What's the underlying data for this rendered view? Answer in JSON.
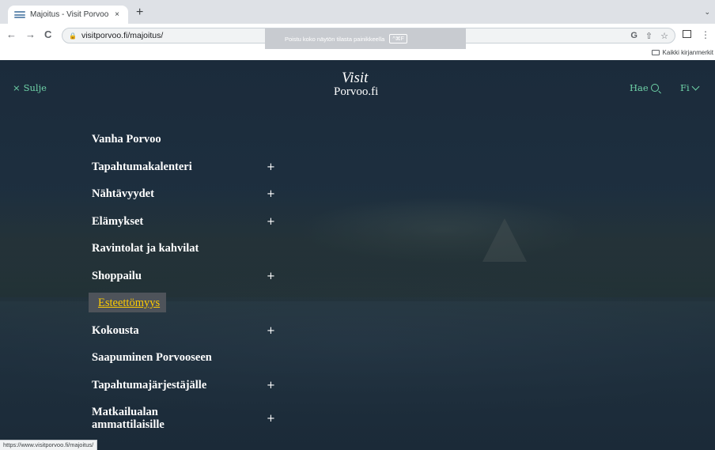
{
  "browser": {
    "tab": {
      "title": "Majoitus - Visit Porvoo",
      "close": "×"
    },
    "new_tab": "+",
    "tab_menu": "⌄",
    "nav": {
      "back": "←",
      "forward": "→",
      "reload": "C"
    },
    "url": "visitporvoo.fi/majoitus/",
    "omni_icons": {
      "google": "G",
      "share": "⇧",
      "star": "☆"
    },
    "fullscreen_banner": {
      "text": "Poistu koko näytön tilasta painikkeella",
      "key": "^⌘F"
    },
    "bookmarks_folder": "Kaikki kirjanmerkit",
    "status_url": "https://www.visitporvoo.fi/majoitus/"
  },
  "header": {
    "close_icon": "×",
    "close_label": "Sulje",
    "logo_top": "Visit",
    "logo_bottom": "Porvoo.fi",
    "search_label": "Hae",
    "lang_label": "Fi"
  },
  "menu": {
    "items": [
      {
        "label": "Vanha Porvoo",
        "expandable": false
      },
      {
        "label": "Tapahtumakalenteri",
        "expandable": true
      },
      {
        "label": "Nähtävyydet",
        "expandable": true
      },
      {
        "label": "Elämykset",
        "expandable": true
      },
      {
        "label": "Ravintolat ja kahvilat",
        "expandable": false
      },
      {
        "label": "Shoppailu",
        "expandable": true
      },
      {
        "label": "Esteettömyys",
        "expandable": false
      },
      {
        "label": "Kokousta",
        "expandable": true
      },
      {
        "label": "Saapuminen Porvooseen",
        "expandable": false
      },
      {
        "label": "Tapahtumajärjestäjälle",
        "expandable": true
      },
      {
        "label": "Matkailualan ammattilaisille",
        "expandable": true
      }
    ],
    "expand_symbol": "+"
  },
  "colors": {
    "accent": "#6fd3a8",
    "highlight_bg": "#4e535a",
    "highlight_text": "#ffcc00",
    "background": "#1b2c3a"
  }
}
